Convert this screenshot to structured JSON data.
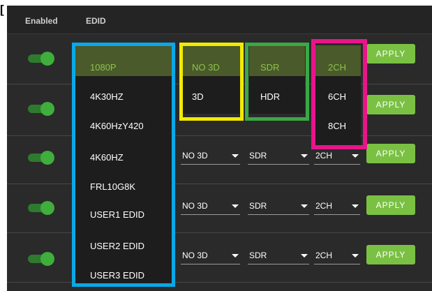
{
  "header": {
    "enabled": "Enabled",
    "edid": "EDID"
  },
  "corner_mark": "[",
  "apply_label": "APPLY",
  "edid_options": [
    "1080P",
    "4K30HZ",
    "4K60HzY420",
    "4K60HZ",
    "FRL10G8K",
    "USER1 EDID",
    "USER2 EDID",
    "USER3 EDID"
  ],
  "edid_selected": "1080P",
  "d3_options": [
    "NO 3D",
    "3D"
  ],
  "d3_selected": "NO 3D",
  "hdr_options": [
    "SDR",
    "HDR"
  ],
  "hdr_selected": "SDR",
  "ch_options": [
    "2CH",
    "6CH",
    "8CH"
  ],
  "ch_selected": "2CH",
  "rows": [
    {
      "enabled": true
    },
    {
      "enabled": true
    },
    {
      "enabled": true,
      "d3": "NO 3D",
      "hdr": "SDR",
      "ch": "2CH"
    },
    {
      "enabled": true,
      "d3": "NO 3D",
      "hdr": "SDR",
      "ch": "2CH"
    },
    {
      "enabled": true,
      "d3": "NO 3D",
      "hdr": "SDR",
      "ch": "2CH"
    }
  ],
  "colors": {
    "edid_highlight": "#0aa8e8",
    "d3_highlight": "#f2ea00",
    "hdr_highlight": "#3aa846",
    "ch_highlight": "#e8158a",
    "apply_button": "#7ac143",
    "toggle_on": "#3fae3c"
  }
}
